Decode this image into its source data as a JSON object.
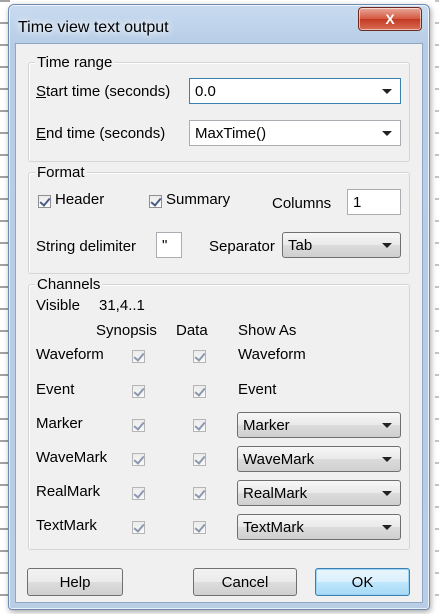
{
  "window": {
    "title": "Time view text output",
    "close_symbol": "X"
  },
  "time_range": {
    "group_label": "Time range",
    "start_label_accel": "S",
    "start_label_rest": "tart time (seconds)",
    "start_value": "0.0",
    "end_label_accel": "E",
    "end_label_rest": "nd time (seconds)",
    "end_value": "MaxTime()"
  },
  "format": {
    "group_label": "Format",
    "header_label": "Header",
    "header_checked": true,
    "summary_label": "Summary",
    "summary_checked": true,
    "columns_label": "Columns",
    "columns_value": "1",
    "string_delimiter_label": "String delimiter",
    "string_delimiter_value": "\"",
    "separator_label": "Separator",
    "separator_value": "Tab"
  },
  "channels": {
    "group_label": "Channels",
    "visible_label": "Visible",
    "visible_value": "31,4..1",
    "col_synopsis": "Synopsis",
    "col_data": "Data",
    "col_show_as": "Show As",
    "rows": [
      {
        "name": "Waveform",
        "synopsis": true,
        "data": true,
        "show_as": "Waveform",
        "show_as_type": "text"
      },
      {
        "name": "Event",
        "synopsis": true,
        "data": true,
        "show_as": "Event",
        "show_as_type": "text"
      },
      {
        "name": "Marker",
        "synopsis": true,
        "data": true,
        "show_as": "Marker",
        "show_as_type": "dropdown"
      },
      {
        "name": "WaveMark",
        "synopsis": true,
        "data": true,
        "show_as": "WaveMark",
        "show_as_type": "dropdown"
      },
      {
        "name": "RealMark",
        "synopsis": true,
        "data": true,
        "show_as": "RealMark",
        "show_as_type": "dropdown"
      },
      {
        "name": "TextMark",
        "synopsis": true,
        "data": true,
        "show_as": "TextMark",
        "show_as_type": "dropdown"
      }
    ]
  },
  "buttons": {
    "help": "Help",
    "cancel": "Cancel",
    "ok": "OK"
  }
}
